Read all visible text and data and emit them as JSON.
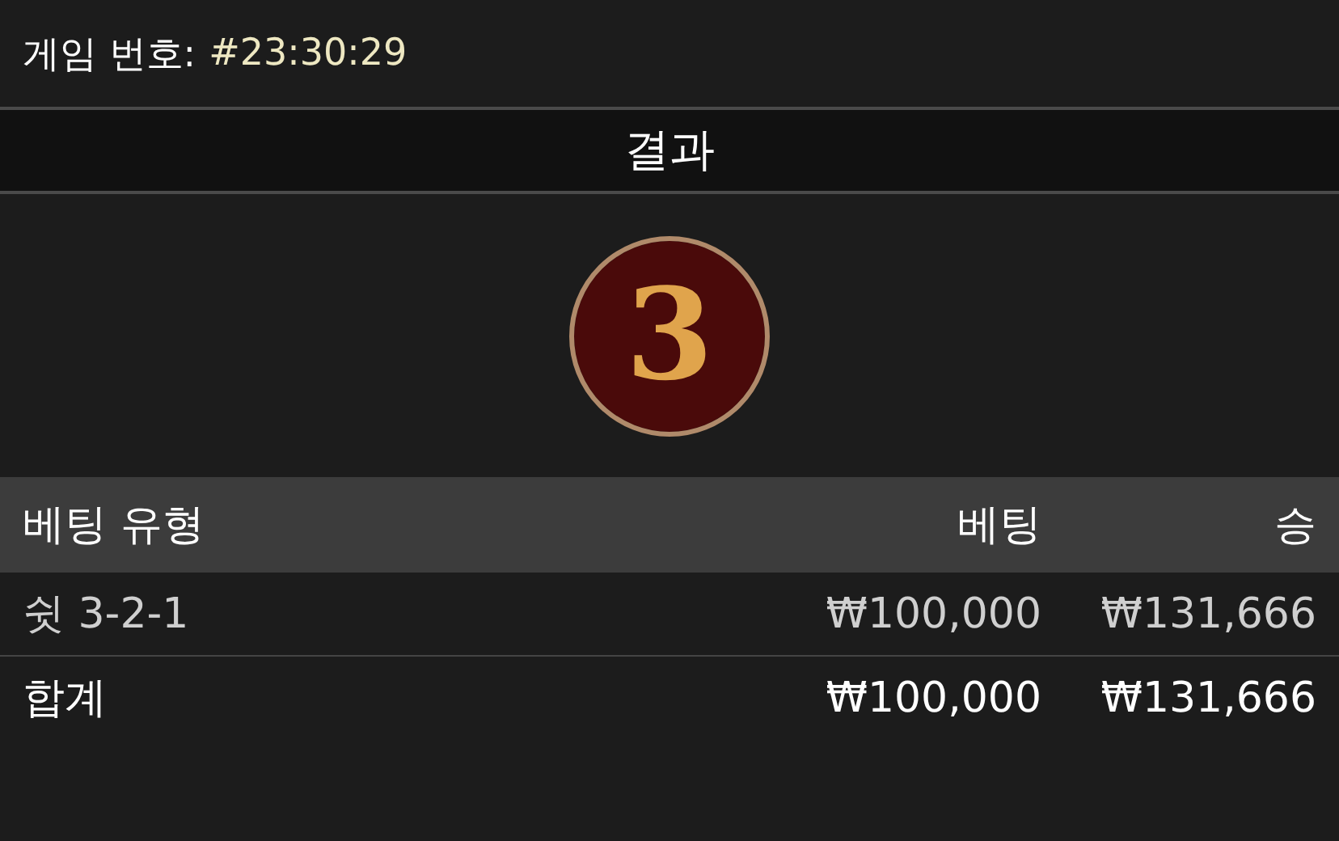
{
  "game": {
    "label": "게임 번호:",
    "number": "#23:30:29"
  },
  "result": {
    "title": "결과",
    "ball": "3"
  },
  "table": {
    "columns": [
      "베팅 유형",
      "베팅",
      "승"
    ],
    "rows": [
      {
        "kind": "bet",
        "cells": [
          "쉿 3-2-1",
          "₩100,000",
          "₩131,666"
        ]
      },
      {
        "kind": "total",
        "cells": [
          "합계",
          "₩100,000",
          "₩131,666"
        ]
      }
    ]
  }
}
